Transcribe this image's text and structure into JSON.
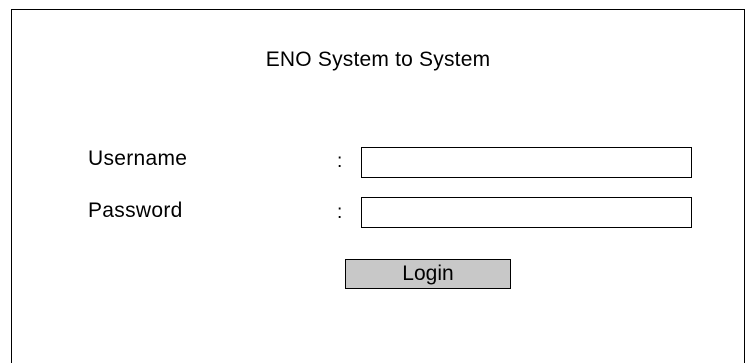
{
  "form": {
    "title": "ENO System to System",
    "username_label": "Username",
    "password_label": "Password",
    "separator": ":",
    "username_value": "",
    "password_value": "",
    "login_label": "Login"
  },
  "colors": {
    "border": "#000000",
    "button_fill": "#c8c8c8",
    "background": "#ffffff"
  }
}
